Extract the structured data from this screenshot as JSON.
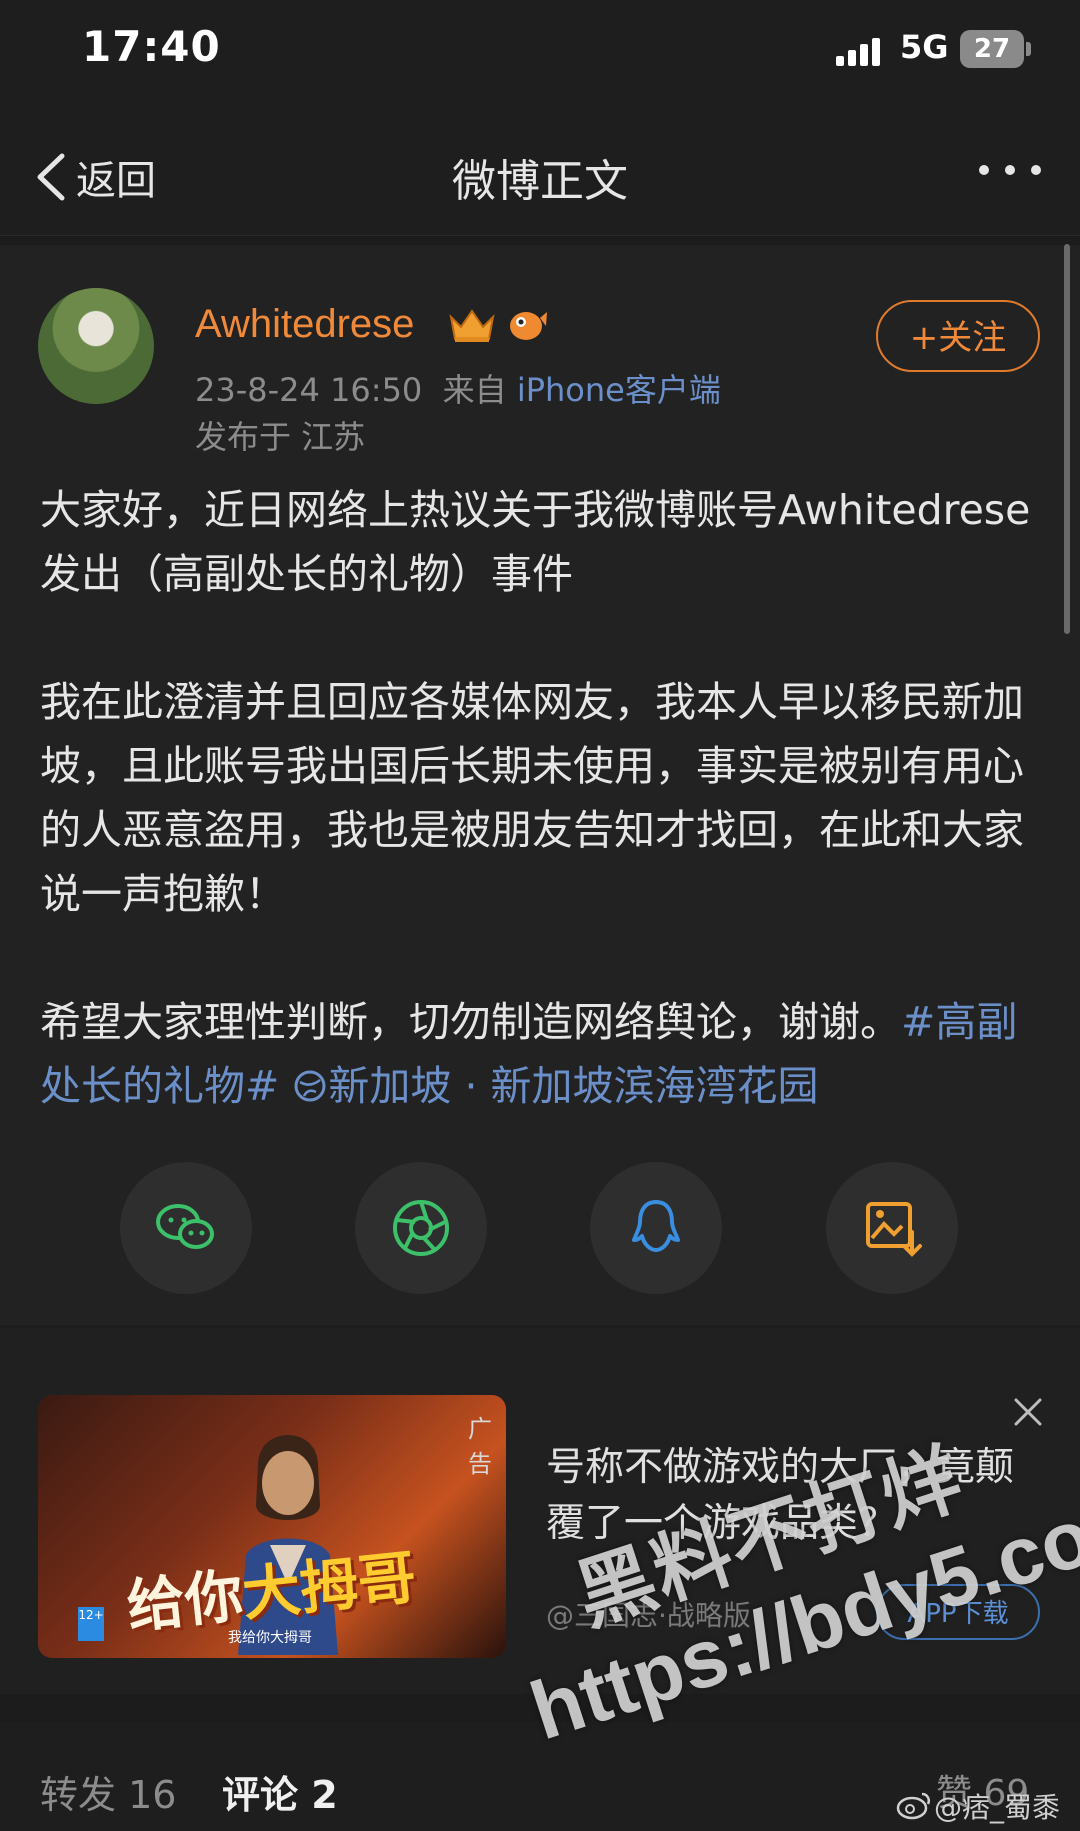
{
  "status_bar": {
    "time": "17:40",
    "network": "5G",
    "battery": "27"
  },
  "nav": {
    "back_label": "返回",
    "title": "微博正文"
  },
  "post": {
    "username": "Awhitedrese",
    "follow_label": "+关注",
    "timestamp": "23-8-24 16:50",
    "source_prefix": "来自",
    "source": "iPhone客户端",
    "location": "发布于 江苏",
    "paragraph1": "大家好，近日网络上热议关于我微博账号Awhitedrese发出（高副处长的礼物）事件",
    "paragraph2": "我在此澄清并且回应各媒体网友，我本人早以移民新加坡，且此账号我出国后长期未使用，事实是被别有用心的人恶意盗用，我也是被朋友告知才找回，在此和大家说一声抱歉！",
    "paragraph3": "希望大家理性判断，切勿制造网络舆论，谢谢。",
    "hashtag": "#高副处长的礼物#",
    "place": "新加坡 · 新加坡滨海湾花园"
  },
  "share_buttons": [
    "wechat-icon",
    "moments-icon",
    "qq-icon",
    "save-image-icon"
  ],
  "ad": {
    "tag": "广告",
    "banner_text_a": "给你",
    "banner_text_b": "大拇哥",
    "banner_sub": "我给你大拇哥",
    "rating": "12+",
    "title": "号称不做游戏的大厂，竟颠覆了一个游戏品类？",
    "source": "@三国志·战略版",
    "app_button": "APP下载"
  },
  "bottom_tabs": {
    "repost": "转发 16",
    "comment": "评论 2",
    "like": "赞 69"
  },
  "credit": "@痞_蜀黍",
  "watermark": {
    "line1": "黑料不打烊",
    "line2": "https://bdy5.co"
  },
  "colors": {
    "accent_orange": "#f08a3a",
    "link_blue": "#6b8fc8",
    "background": "#1c1c1c"
  }
}
